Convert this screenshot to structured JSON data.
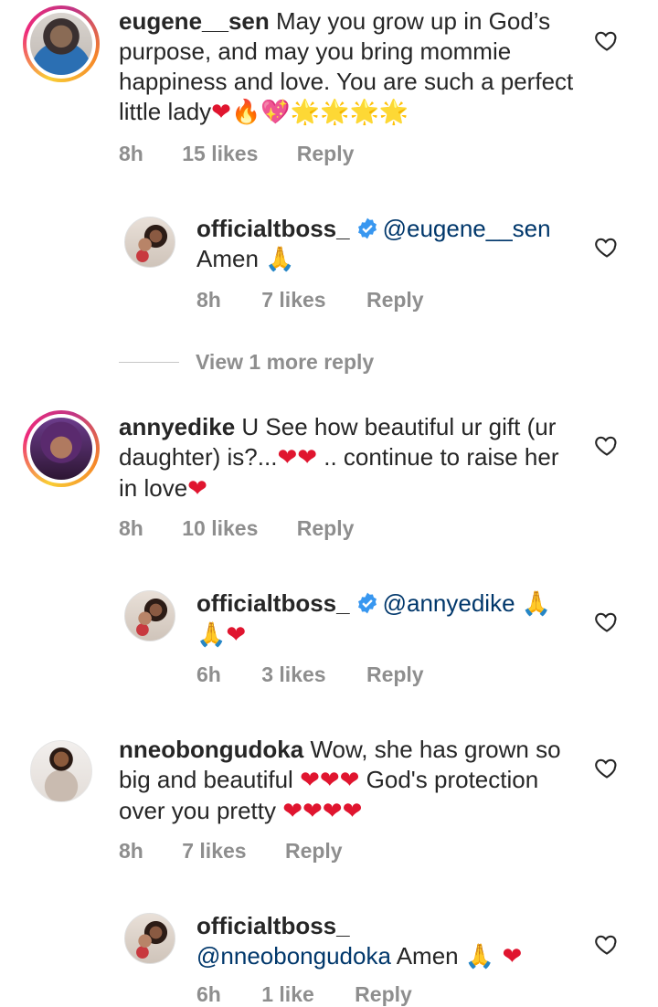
{
  "comments": [
    {
      "username": "eugene__sen",
      "text": "May you grow up in God’s purpose, and may you bring mommie happiness and love. You are such a perfect little lady",
      "emojis": "❤️🔥💖🌟🌟🌟🌟",
      "time": "8h",
      "likes": "15 likes",
      "reply": "Reply",
      "has_story_ring": true
    },
    {
      "username": "officialtboss_",
      "verified": true,
      "mention": "@eugene__sen",
      "text": "Amen",
      "emojis": "🙏🏽",
      "time": "8h",
      "likes": "7 likes",
      "reply": "Reply",
      "is_reply": true
    },
    {
      "username": "annyedike",
      "text_part1": "U See how beautiful ur gift (ur daughter) is?...",
      "emojis_1": "❤️❤️",
      "text_part2": ".. continue to raise her in love",
      "emojis_2": "❤️",
      "time": "8h",
      "likes": "10 likes",
      "reply": "Reply",
      "has_story_ring": true
    },
    {
      "username": "officialtboss_",
      "verified": true,
      "mention": "@annyedike",
      "emojis": "🙏🏽🙏🏽❤️",
      "time": "6h",
      "likes": "3 likes",
      "reply": "Reply",
      "is_reply": true
    },
    {
      "username": "nneobongudoka",
      "text_part1": "Wow, she has grown so big and beautiful",
      "emojis_1": "❤️❤️❤️",
      "text_part2": "God's protection over you pretty",
      "emojis_2": "❤️❤️❤️❤️",
      "time": "8h",
      "likes": "7 likes",
      "reply": "Reply"
    },
    {
      "username": "officialtboss_",
      "mention": "@nneobongudoka",
      "text": "Amen",
      "emojis": "🙏🏽 ❤️",
      "time": "6h",
      "likes": "1 like",
      "reply": "Reply",
      "is_reply": true
    }
  ],
  "view_more_replies": "View 1 more reply",
  "colors": {
    "text": "#262626",
    "meta": "#8e8e8e",
    "mention": "#00376b",
    "verified": "#3897f0",
    "heart": "#e0152f"
  },
  "icons": {
    "like": "heart-outline-icon",
    "verified": "verified-badge-icon"
  }
}
